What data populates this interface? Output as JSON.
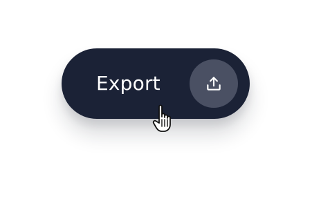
{
  "export_button": {
    "label": "Export",
    "icon": "upload-icon",
    "background_color": "#1b2236",
    "icon_circle_color": "#4a5063",
    "label_color": "#ffffff"
  },
  "pointer": {
    "icon": "hand-pointer-icon"
  }
}
